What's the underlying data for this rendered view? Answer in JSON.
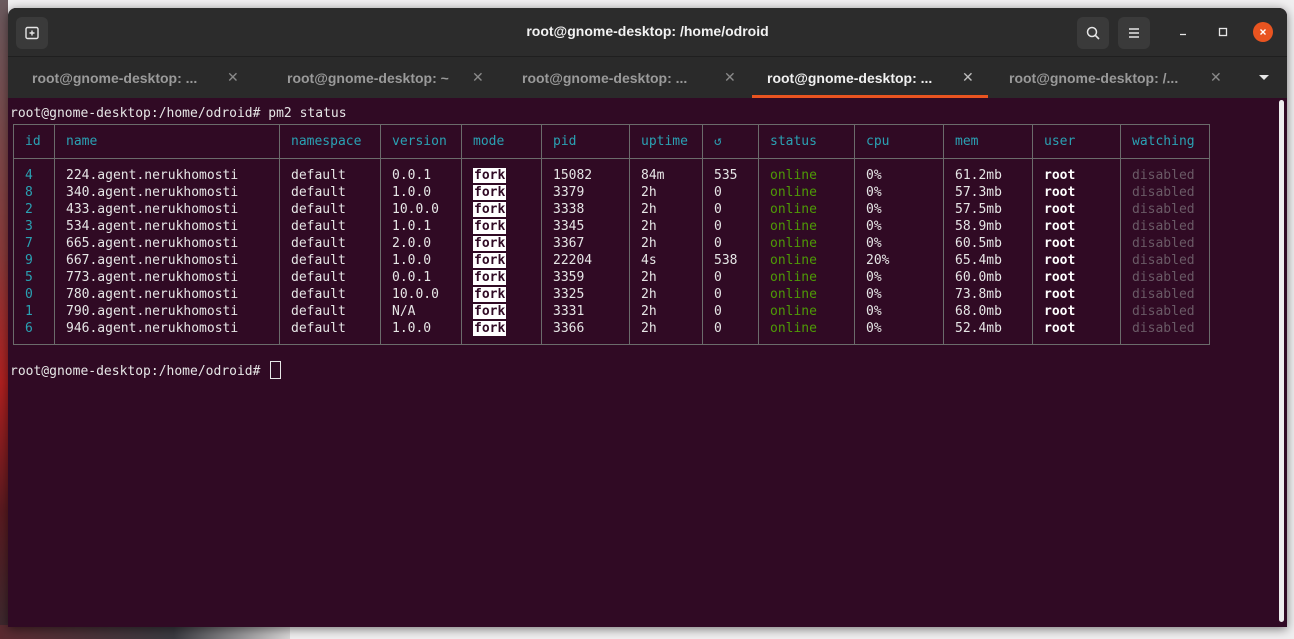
{
  "window": {
    "title": "root@gnome-desktop: /home/odroid"
  },
  "tabs": [
    {
      "label": "root@gnome-desktop: ...",
      "active": false
    },
    {
      "label": "root@gnome-desktop: ~",
      "active": false
    },
    {
      "label": "root@gnome-desktop: ...",
      "active": false
    },
    {
      "label": "root@gnome-desktop: ...",
      "active": true
    },
    {
      "label": "root@gnome-desktop: /...",
      "active": false
    }
  ],
  "terminal": {
    "command_line": "root@gnome-desktop:/home/odroid# pm2 status",
    "prompt_line": "root@gnome-desktop:/home/odroid# ",
    "headers": [
      "id",
      "name",
      "namespace",
      "version",
      "mode",
      "pid",
      "uptime",
      "↺",
      "status",
      "cpu",
      "mem",
      "user",
      "watching"
    ],
    "rows": [
      [
        "4",
        "224.agent.nerukhomosti",
        "default",
        "0.0.1",
        "fork",
        "15082",
        "84m",
        "535",
        "online",
        "0%",
        "61.2mb",
        "root",
        "disabled"
      ],
      [
        "8",
        "340.agent.nerukhomosti",
        "default",
        "1.0.0",
        "fork",
        "3379",
        "2h",
        "0",
        "online",
        "0%",
        "57.3mb",
        "root",
        "disabled"
      ],
      [
        "2",
        "433.agent.nerukhomosti",
        "default",
        "10.0.0",
        "fork",
        "3338",
        "2h",
        "0",
        "online",
        "0%",
        "57.5mb",
        "root",
        "disabled"
      ],
      [
        "3",
        "534.agent.nerukhomosti",
        "default",
        "1.0.1",
        "fork",
        "3345",
        "2h",
        "0",
        "online",
        "0%",
        "58.9mb",
        "root",
        "disabled"
      ],
      [
        "7",
        "665.agent.nerukhomosti",
        "default",
        "2.0.0",
        "fork",
        "3367",
        "2h",
        "0",
        "online",
        "0%",
        "60.5mb",
        "root",
        "disabled"
      ],
      [
        "9",
        "667.agent.nerukhomosti",
        "default",
        "1.0.0",
        "fork",
        "22204",
        "4s",
        "538",
        "online",
        "20%",
        "65.4mb",
        "root",
        "disabled"
      ],
      [
        "5",
        "773.agent.nerukhomosti",
        "default",
        "0.0.1",
        "fork",
        "3359",
        "2h",
        "0",
        "online",
        "0%",
        "60.0mb",
        "root",
        "disabled"
      ],
      [
        "0",
        "780.agent.nerukhomosti",
        "default",
        "10.0.0",
        "fork",
        "3325",
        "2h",
        "0",
        "online",
        "0%",
        "73.8mb",
        "root",
        "disabled"
      ],
      [
        "1",
        "790.agent.nerukhomosti",
        "default",
        "N/A",
        "fork",
        "3331",
        "2h",
        "0",
        "online",
        "0%",
        "68.0mb",
        "root",
        "disabled"
      ],
      [
        "6",
        "946.agent.nerukhomosti",
        "default",
        "1.0.0",
        "fork",
        "3366",
        "2h",
        "0",
        "online",
        "0%",
        "52.4mb",
        "root",
        "disabled"
      ]
    ]
  },
  "colors": {
    "terminal_bg": "#300a24",
    "accent": "#e95420",
    "header_text": "#2aa1b3",
    "online": "#4e9a06"
  },
  "icons": {
    "new_tab": "new-tab-icon",
    "search": "search-icon",
    "menu": "hamburger-menu-icon",
    "minimize": "minimize-icon",
    "maximize": "maximize-icon",
    "close": "close-icon"
  }
}
